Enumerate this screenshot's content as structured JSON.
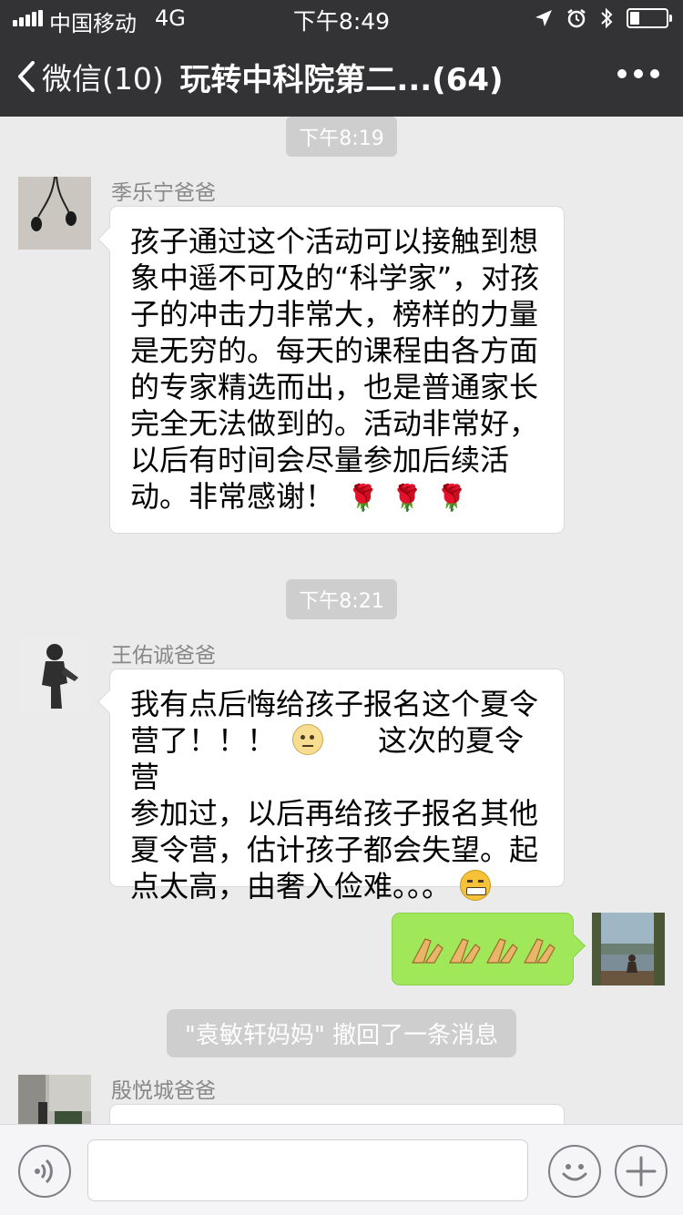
{
  "status_bar": {
    "carrier": "中国移动",
    "network": "4G",
    "time": "下午8:49"
  },
  "nav": {
    "back_label": "微信(10)",
    "title": "玩转中科院第二...(64)"
  },
  "messages": [
    {
      "timestamp": "下午8:19",
      "sender": "季乐宁爸爸",
      "lines": [
        "孩子通过这个活动可以接触到想",
        "象中遥不可及的“科学家”，对孩",
        "子的冲击力非常大，榜样的力量",
        "是无穷的。每天的课程由各方面",
        "的专家精选而出，也是普通家长",
        "完全无法做到的。活动非常好，",
        "以后有时间会尽量参加后续活",
        "动。非常感谢！"
      ]
    },
    {
      "timestamp": "下午8:21",
      "sender": "王佑诚爸爸",
      "line1": "我有点后悔给孩子报名这个夏令",
      "line2a": "营了！！！",
      "line2b": "这次的夏令营",
      "line3": "参加过，以后再给孩子报名其他",
      "line4": "夏令营，估计孩子都会失望。起",
      "line5": "点太高，由奢入俭难。。。"
    }
  ],
  "self_message": {
    "emoji_count": 4
  },
  "system_notice": "\"袁敏轩妈妈\" 撤回了一条消息",
  "last_sender": "殷悦城爸爸",
  "colors": {
    "header_bg": "#333336",
    "chat_bg": "#ebebeb",
    "self_bubble": "#a0e75a"
  }
}
